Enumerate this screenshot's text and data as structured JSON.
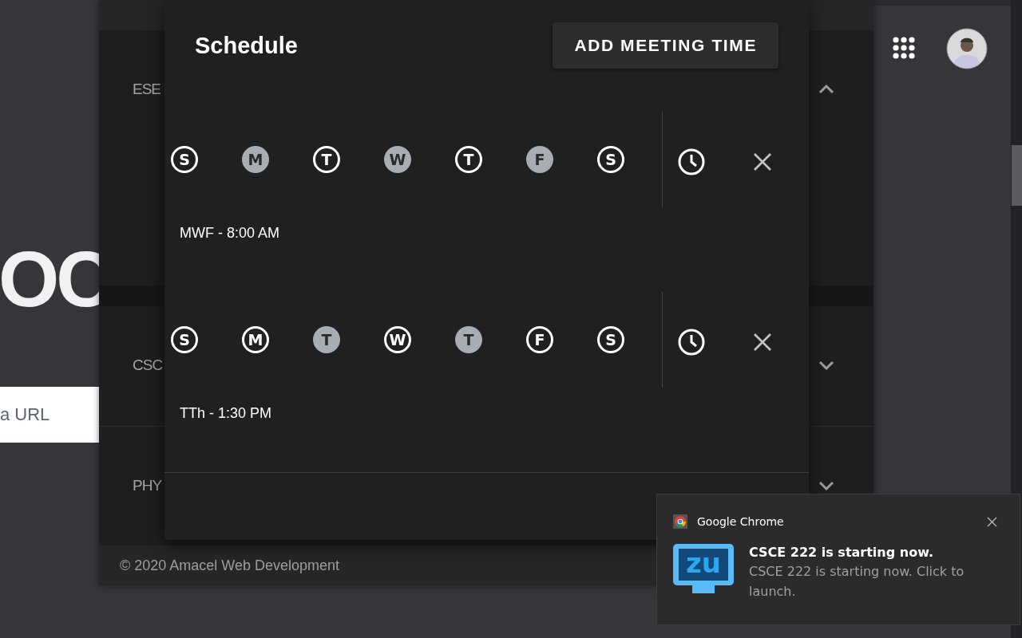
{
  "page": {
    "heading_fragment": "OC",
    "url_field": {
      "placeholder": "a URL"
    }
  },
  "popup": {
    "courses": [
      {
        "label": "ESE",
        "expanded": true
      },
      {
        "label": "CSC",
        "expanded": false
      },
      {
        "label": "PHY",
        "expanded": false
      }
    ],
    "footer": "© 2020 Amacel Web Development"
  },
  "dialog": {
    "title": "Schedule",
    "add_button": "ADD MEETING TIME",
    "meetings": [
      {
        "days": [
          {
            "letter": "S",
            "selected": false
          },
          {
            "letter": "M",
            "selected": true
          },
          {
            "letter": "T",
            "selected": false
          },
          {
            "letter": "W",
            "selected": true
          },
          {
            "letter": "T",
            "selected": false
          },
          {
            "letter": "F",
            "selected": true
          },
          {
            "letter": "S",
            "selected": false
          }
        ],
        "summary": "MWF - 8:00 AM"
      },
      {
        "days": [
          {
            "letter": "S",
            "selected": false
          },
          {
            "letter": "M",
            "selected": false
          },
          {
            "letter": "T",
            "selected": true
          },
          {
            "letter": "W",
            "selected": false
          },
          {
            "letter": "T",
            "selected": true
          },
          {
            "letter": "F",
            "selected": false
          },
          {
            "letter": "S",
            "selected": false
          }
        ],
        "summary": "TTh - 1:30 PM"
      }
    ]
  },
  "notification": {
    "app": "Google Chrome",
    "icon_text": "zu",
    "title": "CSCE 222 is starting now.",
    "body": "CSCE 222 is starting now. Click to launch."
  }
}
